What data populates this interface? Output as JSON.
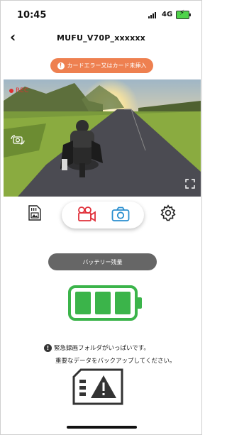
{
  "status_bar": {
    "time": "10:45",
    "network": "4G",
    "battery_icon": "battery-charging-icon"
  },
  "header": {
    "back_icon": "back-chevron-icon",
    "title": "MUFU_V70P_xxxxxx"
  },
  "alert": {
    "icon": "info-icon",
    "text": "カードエラー又はカード未挿入",
    "color": "#ee8050"
  },
  "live_view": {
    "rec_label": "REC",
    "rec_color": "#e03030"
  },
  "actions": {
    "file_icon": "sd-file-icon",
    "video_icon": "video-record-icon",
    "photo_icon": "camera-icon",
    "settings_icon": "gear-icon",
    "active_color": "#e0303a",
    "photo_color": "#2a8fcf"
  },
  "battery": {
    "label": "バッテリー残量",
    "level": "3/3",
    "color": "#3bb44a"
  },
  "warning": {
    "icon": "info-icon",
    "line1": "緊急録画フォルダがいっぱいです。",
    "line2": "重要なデータをバックアップしてください。",
    "card_icon": "sd-card-warning-icon"
  }
}
